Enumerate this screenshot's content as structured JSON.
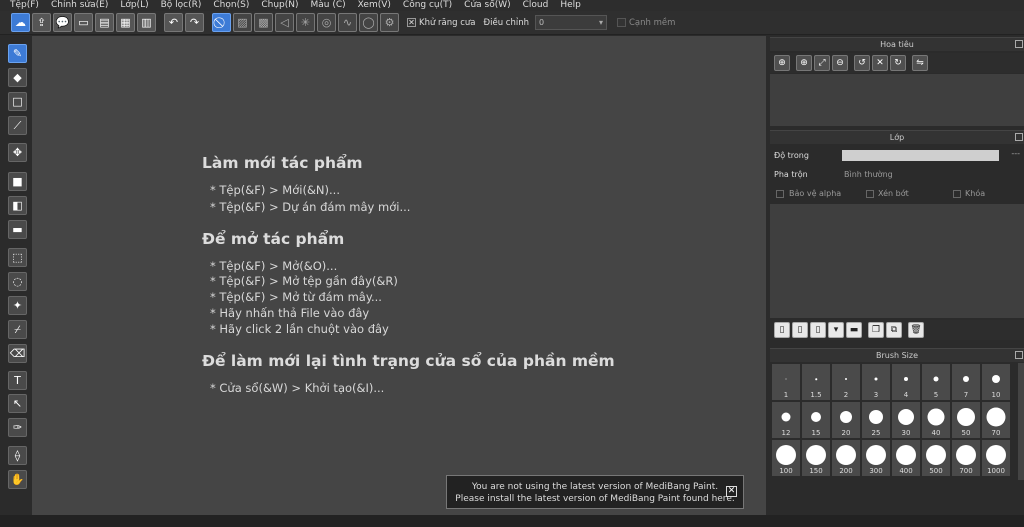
{
  "menu": [
    "Tệp(F)",
    "Chỉnh sửa(E)",
    "Lớp(L)",
    "Bộ lọc(R)",
    "Chọn(S)",
    "Chụp(N)",
    "Màu (C)",
    "Xem(V)",
    "Công cụ(T)",
    "Cửa sổ(W)",
    "Cloud",
    "Help"
  ],
  "toolbar": {
    "antialias_label": "Khử răng cưa",
    "adjust_label": "Điều chỉnh",
    "adjust_value": "0",
    "smooth_label": "Cạnh mềm"
  },
  "canvas": {
    "section1_title": "Làm mới tác phẩm",
    "section1_lines": [
      "* Tệp(&F) > Mới(&N)...",
      "* Tệp(&F) > Dự án đám mây mới..."
    ],
    "section2_title": "Để mở tác phẩm",
    "section2_lines": [
      "* Tệp(&F) > Mở(&O)...",
      "* Tệp(&F) > Mở tệp gần đây(&R)",
      "* Tệp(&F) > Mở từ đám mây...",
      "* Hãy nhấn thả File vào đây",
      "* Hãy click 2 lần chuột vào đây"
    ],
    "section3_title": "Để làm mới lại tình trạng cửa sổ của phần mềm",
    "section3_lines": [
      "* Cửa sổ(&W) > Khởi tạo(&I)..."
    ]
  },
  "notice": {
    "line1": "You are not using the latest version of MediBang Paint.",
    "line2": "Please install the latest version of MediBang Paint found here."
  },
  "navigator": {
    "title": "Hoa tiêu"
  },
  "layer": {
    "title": "Lớp",
    "opacity_label": "Độ trong",
    "opacity_value": "---",
    "blend_label": "Pha trộn",
    "blend_value": "Bình thường",
    "protect_alpha": "Bảo vệ alpha",
    "clipping": "Xén bớt",
    "lock": "Khóa"
  },
  "brush_size": {
    "title": "Brush Size",
    "sizes": [
      "1",
      "1.5",
      "2",
      "3",
      "4",
      "5",
      "7",
      "10",
      "12",
      "15",
      "20",
      "25",
      "30",
      "40",
      "50",
      "70",
      "100",
      "150",
      "200",
      "300",
      "400",
      "500",
      "700",
      "1000"
    ]
  }
}
